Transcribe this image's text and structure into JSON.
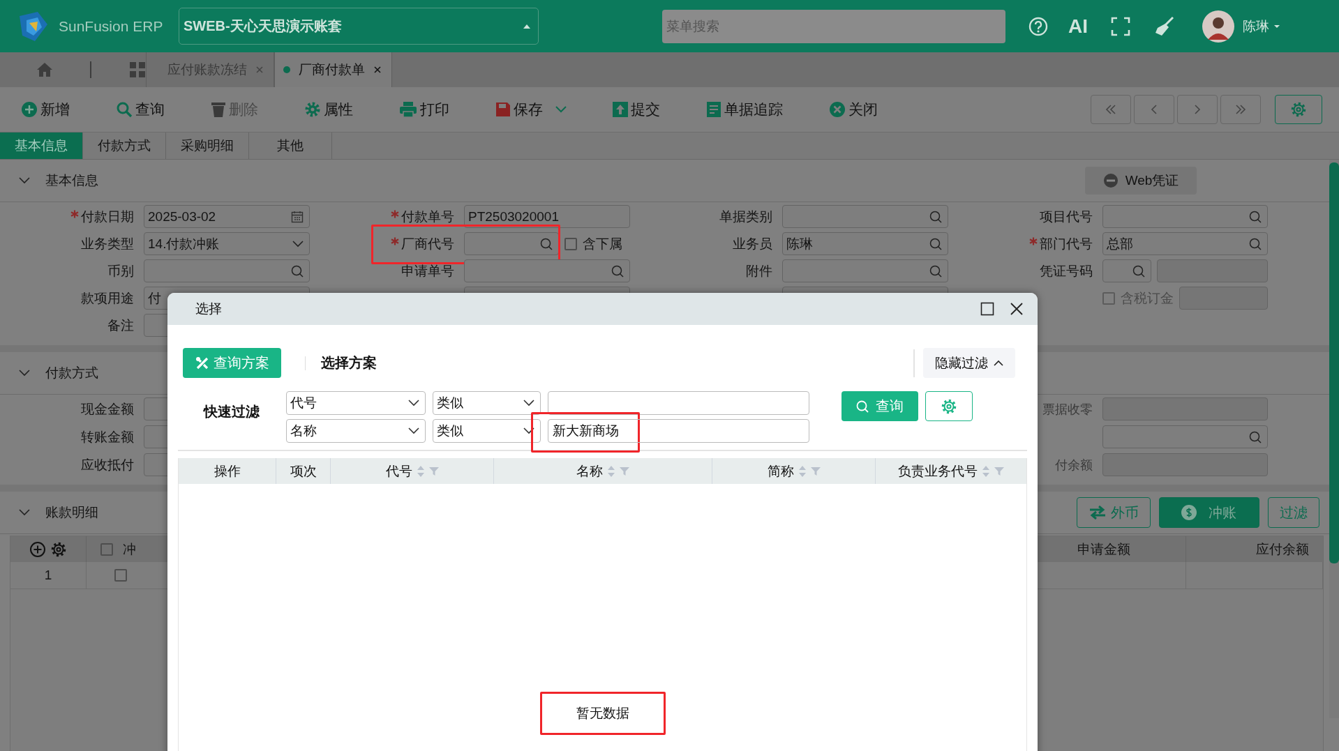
{
  "app": {
    "logo_text": "SunFusion ERP",
    "account": "SWEB-天心天思演示账套",
    "search": {
      "placeholder": "菜单搜索"
    },
    "ai_label": "AI",
    "user": "陈琳"
  },
  "doc_tabs": [
    {
      "label": "应付账款冻结",
      "selected": false
    },
    {
      "label": "厂商付款单",
      "selected": true
    }
  ],
  "toolbar": [
    {
      "label": "新增",
      "kind": "add",
      "disabled": false,
      "dropdown": false
    },
    {
      "label": "查询",
      "kind": "search",
      "disabled": false,
      "dropdown": false
    },
    {
      "label": "删除",
      "kind": "delete",
      "disabled": true,
      "dropdown": false
    },
    {
      "label": "属性",
      "kind": "props",
      "disabled": false,
      "dropdown": false
    },
    {
      "label": "打印",
      "kind": "print",
      "disabled": false,
      "dropdown": false
    },
    {
      "label": "保存",
      "kind": "save",
      "disabled": false,
      "dropdown": true
    },
    {
      "label": "提交",
      "kind": "submit",
      "disabled": false,
      "dropdown": false
    },
    {
      "label": "单据追踪",
      "kind": "trace",
      "disabled": false,
      "dropdown": false
    },
    {
      "label": "关闭",
      "kind": "close",
      "disabled": false,
      "dropdown": false
    }
  ],
  "sub_tabs": [
    {
      "label": "基本信息",
      "selected": true
    },
    {
      "label": "付款方式",
      "selected": false
    },
    {
      "label": "采购明细",
      "selected": false
    },
    {
      "label": "其他",
      "selected": false
    }
  ],
  "basic_info": {
    "title": "基本信息",
    "expanded": true,
    "voucher_button": "Web凭证",
    "rows": [
      [
        {
          "kind": "date",
          "label": "付款日期",
          "required": true,
          "value": "2025-03-02"
        },
        {
          "kind": "text",
          "label": "付款单号",
          "required": true,
          "value": "PT2503020001"
        },
        {
          "kind": "search",
          "label": "单据类别",
          "required": false
        },
        {
          "kind": "search",
          "label": "项目代号",
          "required": false
        }
      ],
      [
        {
          "kind": "select",
          "label": "业务类型",
          "required": false,
          "value": "14.付款冲账"
        },
        {
          "kind": "search_check",
          "label": "厂商代号",
          "required": true,
          "highlighted": true,
          "check_label": "含下属",
          "checked": false
        },
        {
          "kind": "search",
          "label": "业务员",
          "required": false,
          "value": "陈琳"
        },
        {
          "kind": "search",
          "label": "部门代号",
          "required": true,
          "value": "总部"
        }
      ],
      [
        {
          "kind": "search",
          "label": "币别",
          "required": false
        },
        {
          "kind": "search",
          "label": "申请单号",
          "required": false
        },
        {
          "kind": "search",
          "label": "附件",
          "required": false
        },
        {
          "kind": "pair",
          "label": "凭证号码",
          "required": false
        }
      ],
      [
        {
          "kind": "text",
          "label": "款项用途",
          "required": false,
          "value": "付"
        },
        {
          "kind": "text"
        },
        {
          "kind": "text"
        },
        {
          "kind": "check_input",
          "check_label": "含税订金",
          "checked": false,
          "disabled": true
        }
      ],
      [
        {
          "kind": "text",
          "label": "备注",
          "required": false
        },
        {
          "kind": "empty"
        },
        {
          "kind": "empty"
        },
        {
          "kind": "empty"
        }
      ]
    ]
  },
  "payment": {
    "title": "付款方式",
    "expanded": true,
    "rows": [
      [
        {
          "kind": "text",
          "label": "现金金额",
          "required": false
        },
        {
          "kind": "empty"
        },
        {
          "kind": "empty"
        },
        {
          "kind": "text",
          "label": "票据收零",
          "required": false,
          "disabled": true
        }
      ],
      [
        {
          "kind": "text",
          "label": "转账金额",
          "required": false
        },
        {
          "kind": "empty"
        },
        {
          "kind": "empty"
        },
        {
          "kind": "search"
        }
      ],
      [
        {
          "kind": "text",
          "label": "应收抵付",
          "required": false
        },
        {
          "kind": "empty"
        },
        {
          "kind": "empty"
        },
        {
          "kind": "text",
          "label": "付余额",
          "required": false,
          "disabled": true
        }
      ]
    ]
  },
  "ledger": {
    "title": "账款明细",
    "expanded": true,
    "buttons": [
      {
        "label": "外币",
        "kind": "exchange"
      },
      {
        "label": "冲账",
        "kind": "settle"
      },
      {
        "label": "过滤",
        "kind": "plain"
      }
    ],
    "columns": [
      {
        "kind": "actions"
      },
      {
        "kind": "check",
        "label": "冲",
        "checked": false
      },
      {
        "kind": "hidden"
      },
      {
        "kind": "text",
        "label": "申请金额"
      },
      {
        "kind": "text",
        "label": "应付余额"
      }
    ],
    "rows": [
      {
        "index": "1",
        "checked": false
      }
    ]
  },
  "dialog": {
    "title": "选择",
    "scheme_button": "查询方案",
    "scheme_label": "选择方案",
    "toggle_filter": "隐藏过滤",
    "filter_label": "快速过滤",
    "filters": [
      {
        "field": "代号",
        "op": "类似",
        "highlighted": false
      },
      {
        "field": "名称",
        "op": "类似",
        "value": "新大新商场",
        "highlighted": true
      }
    ],
    "query_button": "查询",
    "columns": [
      {
        "label": "操作",
        "sortable": false
      },
      {
        "label": "项次",
        "sortable": false
      },
      {
        "label": "代号",
        "sortable": true
      },
      {
        "label": "名称",
        "sortable": true
      },
      {
        "label": "简称",
        "sortable": true
      },
      {
        "label": "负责业务代号",
        "sortable": true
      }
    ],
    "empty_text": "暂无数据",
    "empty_highlighted": true
  }
}
